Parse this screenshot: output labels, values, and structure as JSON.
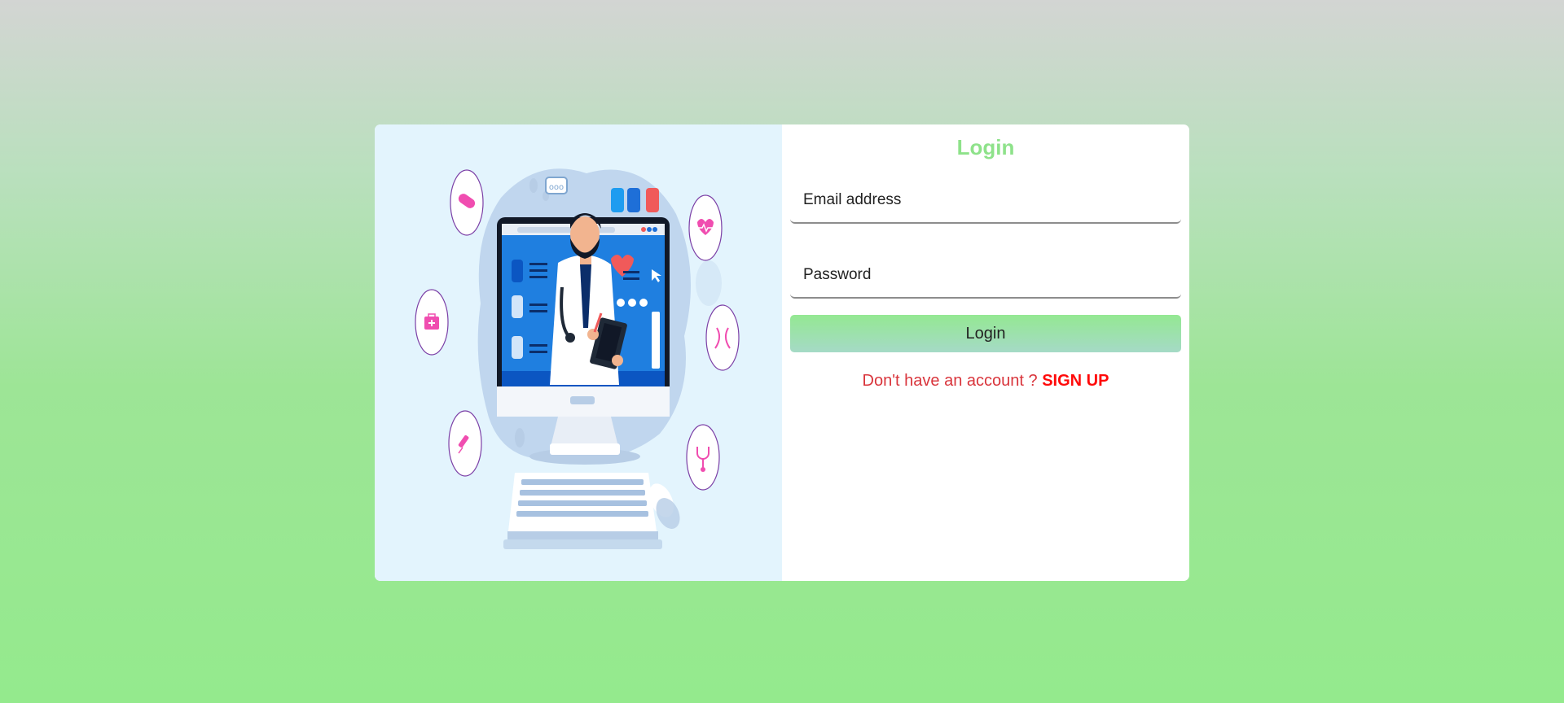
{
  "login": {
    "title": "Login",
    "email_placeholder": "Email address",
    "password_placeholder": "Password",
    "button_label": "Login",
    "signup_prompt": "Don't have an account ?",
    "signup_link": "SIGN UP"
  },
  "illustration": {
    "icons": [
      "bandage-icon",
      "heart-rate-icon",
      "first-aid-kit-icon",
      "dna-icon",
      "syringe-icon",
      "stethoscope-icon"
    ]
  },
  "colors": {
    "title": "#8ee28a",
    "signup_text": "#d9353c",
    "signup_link": "#ff0a0a",
    "button_gradient_top": "#94e892",
    "button_gradient_bottom": "#a5dac6",
    "illustration_bg": "#e3f4fd"
  }
}
